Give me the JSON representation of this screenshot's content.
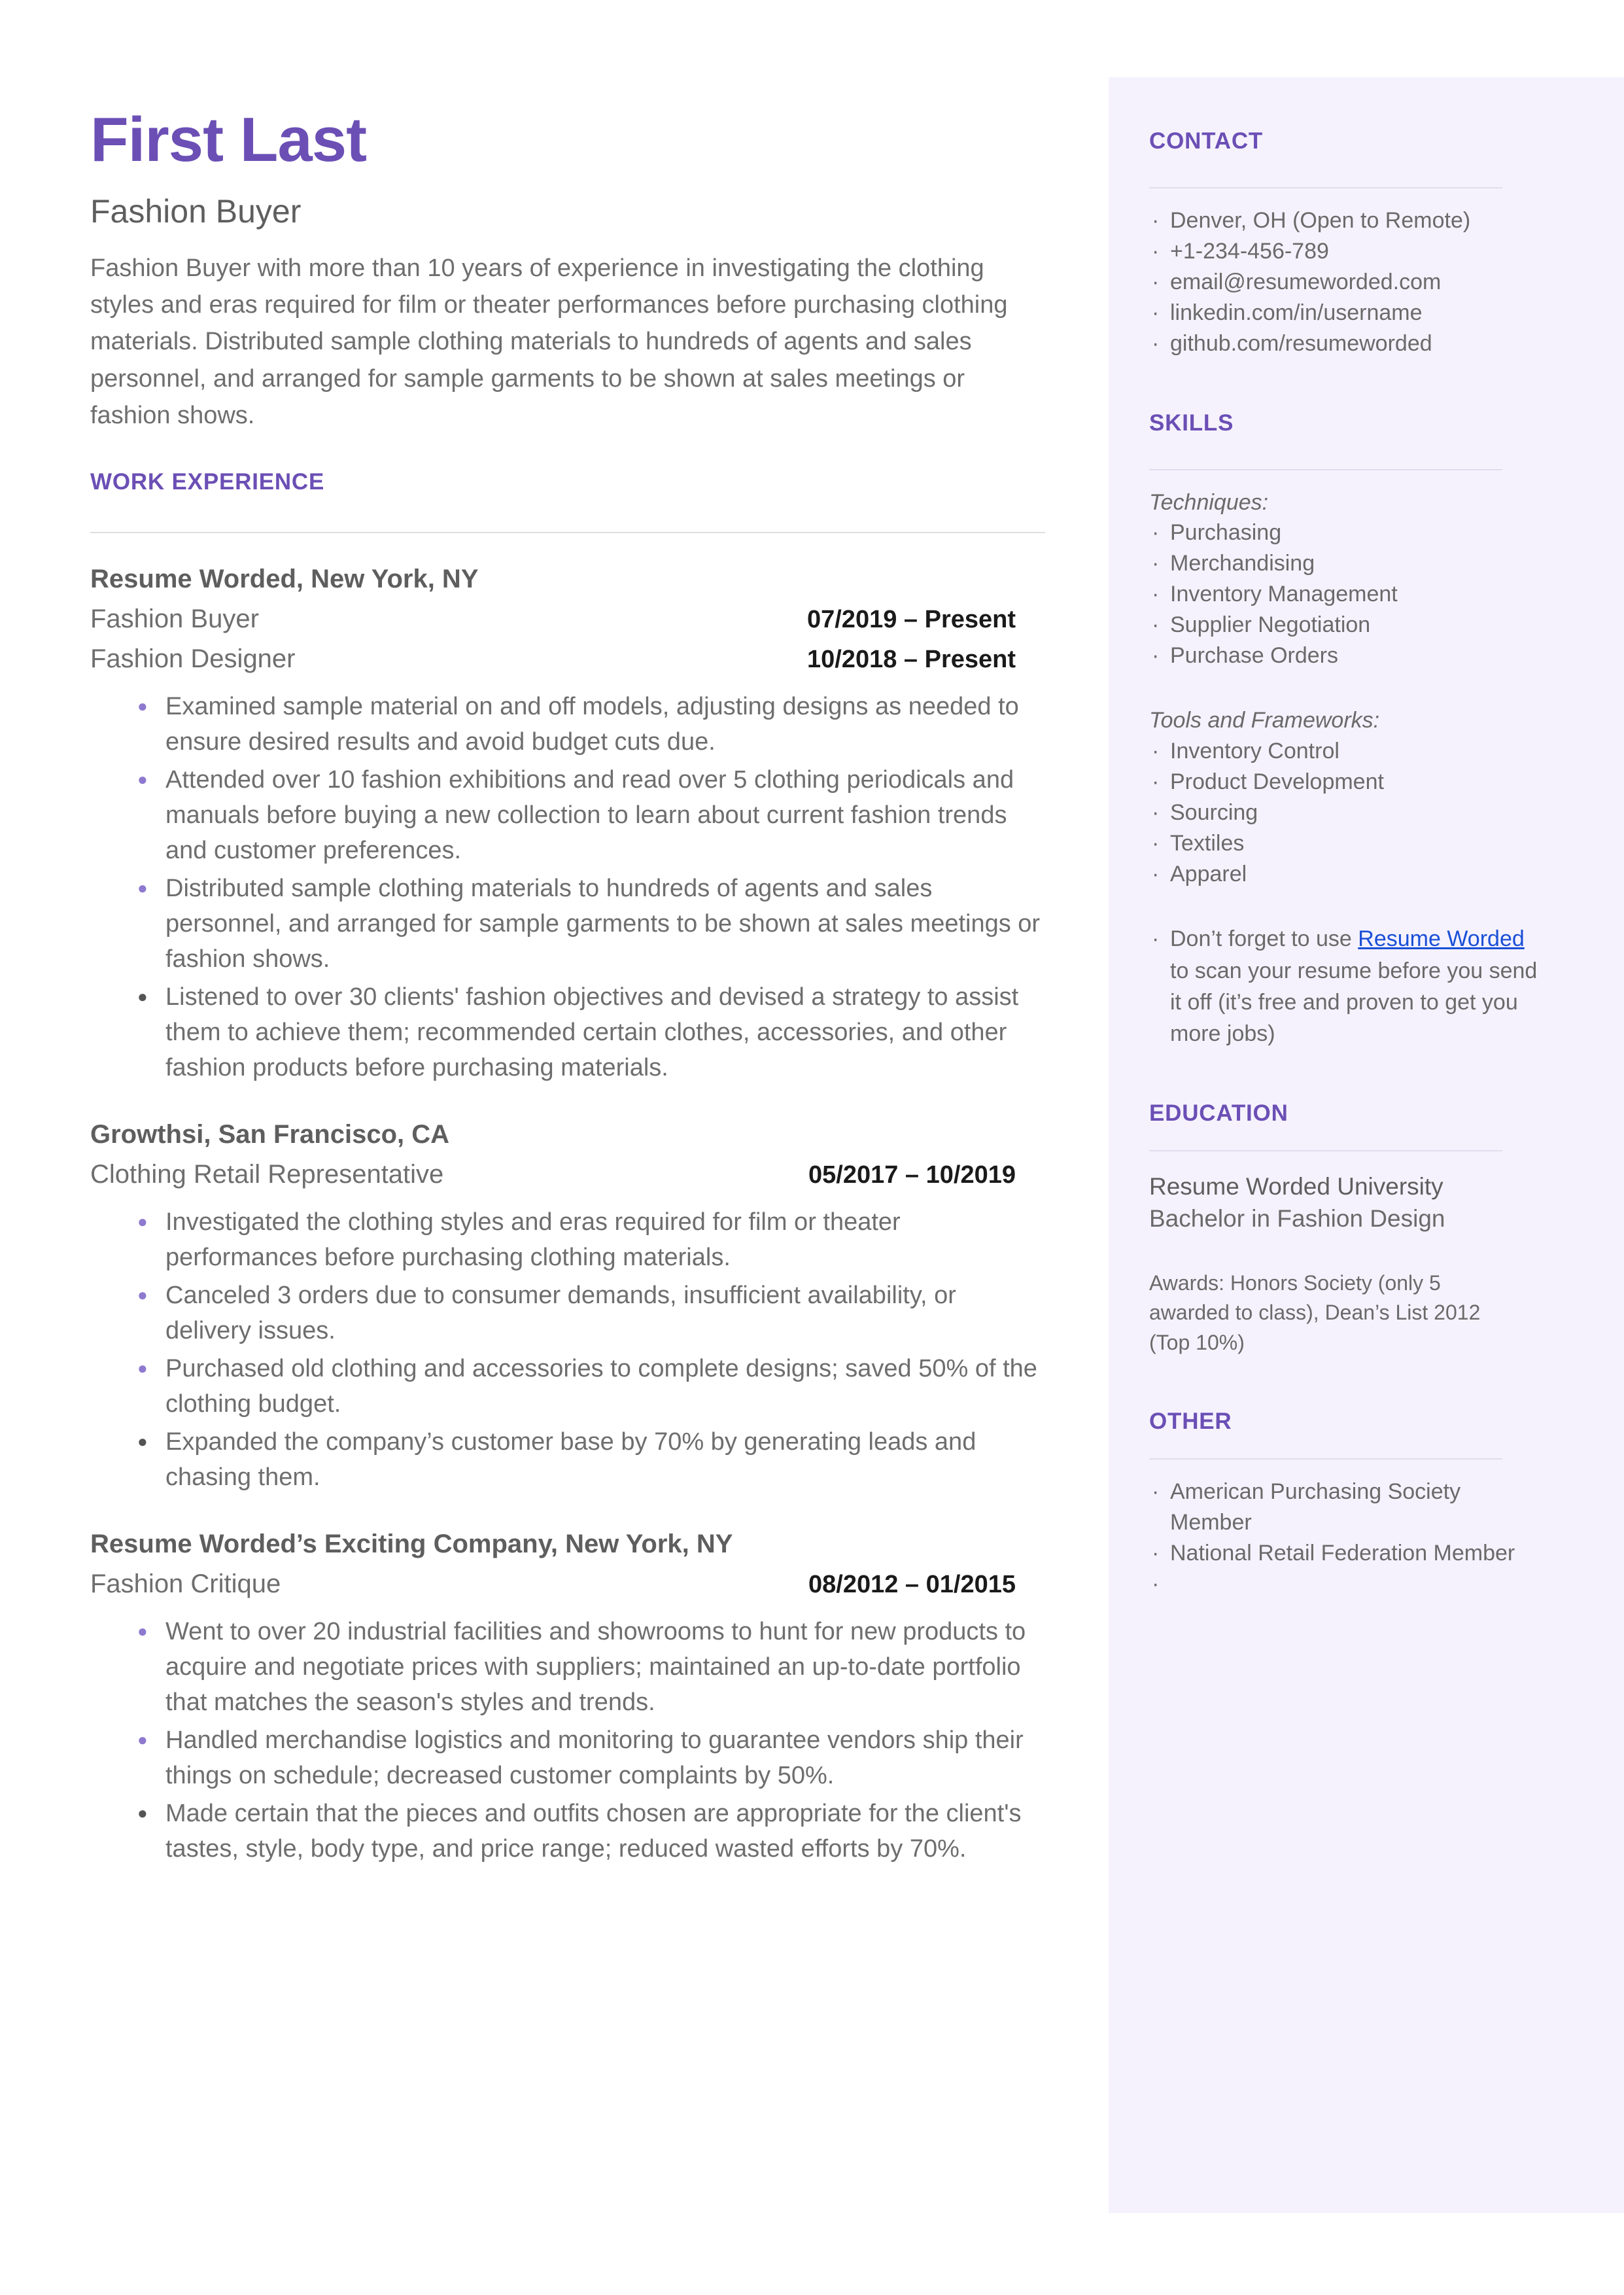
{
  "header": {
    "name": "First Last",
    "headline": "Fashion Buyer",
    "summary": "Fashion Buyer with more than 10 years of experience in investigating the clothing styles and eras required for film or theater performances before purchasing clothing materials. Distributed sample clothing materials to hundreds of agents and sales personnel, and arranged for sample garments to be shown at sales meetings or fashion shows."
  },
  "work_experience": {
    "section_title": "WORK EXPERIENCE",
    "jobs": [
      {
        "company": "Resume Worded, New York, NY",
        "roles": [
          {
            "title": "Fashion Buyer",
            "dates": "07/2019 – Present"
          },
          {
            "title": "Fashion Designer",
            "dates": "10/2018 – Present"
          }
        ],
        "bullets": [
          "Examined sample material on and off models, adjusting designs as needed to ensure desired results and avoid budget cuts due.",
          "Attended over 10 fashion exhibitions and read over 5 clothing periodicals and manuals before buying a new collection to learn about current fashion trends and customer preferences.",
          "Distributed sample clothing materials to hundreds of agents and sales personnel, and arranged for sample garments to be shown at sales meetings or fashion shows.",
          "Listened to over 30 clients' fashion objectives and devised a strategy to assist them to achieve them; recommended certain clothes, accessories, and other fashion products before purchasing materials."
        ]
      },
      {
        "company": "Growthsi, San Francisco, CA",
        "roles": [
          {
            "title": "Clothing Retail Representative",
            "dates": "05/2017 – 10/2019"
          }
        ],
        "bullets": [
          "Investigated the clothing styles and eras required for film or theater performances before purchasing clothing materials.",
          "Canceled 3 orders due to consumer demands, insufficient availability, or delivery issues.",
          "Purchased old clothing and accessories to complete designs; saved 50% of the clothing budget.",
          "Expanded the company’s customer base by 70% by generating leads and chasing them."
        ]
      },
      {
        "company": "Resume Worded’s Exciting Company, New York, NY",
        "roles": [
          {
            "title": "Fashion Critique",
            "dates": "08/2012 – 01/2015"
          }
        ],
        "bullets": [
          "Went to over 20 industrial facilities and showrooms to hunt for new products to acquire and negotiate prices with suppliers; maintained an up-to-date portfolio that matches the season's styles and trends.",
          "Handled merchandise logistics and monitoring to guarantee vendors ship their things on schedule; decreased customer complaints by 50%.",
          "Made certain that the pieces and outfits chosen are appropriate for the client's tastes, style, body type, and price range; reduced wasted efforts by 70%."
        ]
      }
    ]
  },
  "sidebar": {
    "contact": {
      "title": "CONTACT",
      "items": [
        " Denver, OH (Open to Remote)",
        "+1-234-456-789",
        "email@resumeworded.com",
        "linkedin.com/in/username",
        "github.com/resumeworded"
      ]
    },
    "skills": {
      "title": "SKILLS",
      "groups": [
        {
          "label": "Techniques:",
          "items": [
            "Purchasing",
            "Merchandising",
            "Inventory Management",
            "Supplier Negotiation",
            "Purchase Orders"
          ]
        },
        {
          "label": "Tools and Frameworks:",
          "items": [
            "Inventory Control",
            "Product Development",
            "Sourcing",
            "Textiles",
            "Apparel"
          ]
        }
      ],
      "promo": {
        "before": " Don’t forget to use ",
        "link_text": "Resume Worded",
        "after": " to scan your resume before you send it off (it’s free and proven to get you more jobs)"
      }
    },
    "education": {
      "title": "EDUCATION",
      "school": "Resume Worded University",
      "degree": "Bachelor in Fashion Design",
      "awards": "Awards: Honors Society (only 5 awarded to class), Dean’s List 2012 (Top 10%)"
    },
    "other": {
      "title": "OTHER",
      "items": [
        " American Purchasing Society Member",
        " National Retail Federation Member",
        ""
      ]
    }
  },
  "colors": {
    "accent_purple": "#6b4fb5",
    "sidebar_bg": "#f5f2fd",
    "body_text": "#6e6e6e",
    "link_blue": "#1a4fd6",
    "bullet_purple": "#8e79cf",
    "bullet_dark": "#545454"
  }
}
